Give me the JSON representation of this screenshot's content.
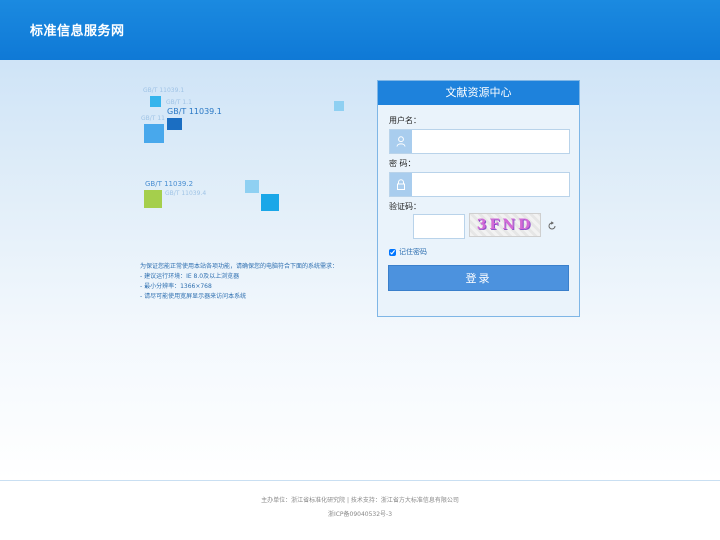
{
  "header": {
    "title": "标准信息服务网"
  },
  "decor": {
    "codes": [
      "GB/T 11039.1",
      "GB/T 1.1",
      "GB/T 11039.1",
      "GB/T 11039.2",
      "GB/T 11039.3",
      "GB/T 11039.4"
    ],
    "colors": {
      "cyan": "#35b4ec",
      "blue": "#1b6ec2",
      "green": "#a5cf4c",
      "light": "#8fd0f2"
    }
  },
  "notice": {
    "lines": [
      "为保证您能正常使用本站各项功能，请确保您的电脑符合下面的系统需求：",
      "- 建议运行环境：IE 8.0及以上浏览器",
      "- 最小分辨率：1366×768",
      "- 请尽可能使用宽屏显示器来访问本系统"
    ]
  },
  "login": {
    "title": "文献资源中心",
    "username_label": "用户名：",
    "username_value": "",
    "password_label": "密  码：",
    "password_value": "",
    "captcha_label": "验证码：",
    "captcha_value": "",
    "captcha_text": "3FND",
    "remember_label": "记住密码",
    "remember_checked": true,
    "submit_label": "登录",
    "icons": [
      "user-icon",
      "lock-icon",
      "refresh-icon"
    ]
  },
  "footer": {
    "line1": "主办单位：浙江省标准化研究院 | 技术支持：浙江省方大标准信息有限公司",
    "line2": "浙ICP备09040532号-3"
  }
}
